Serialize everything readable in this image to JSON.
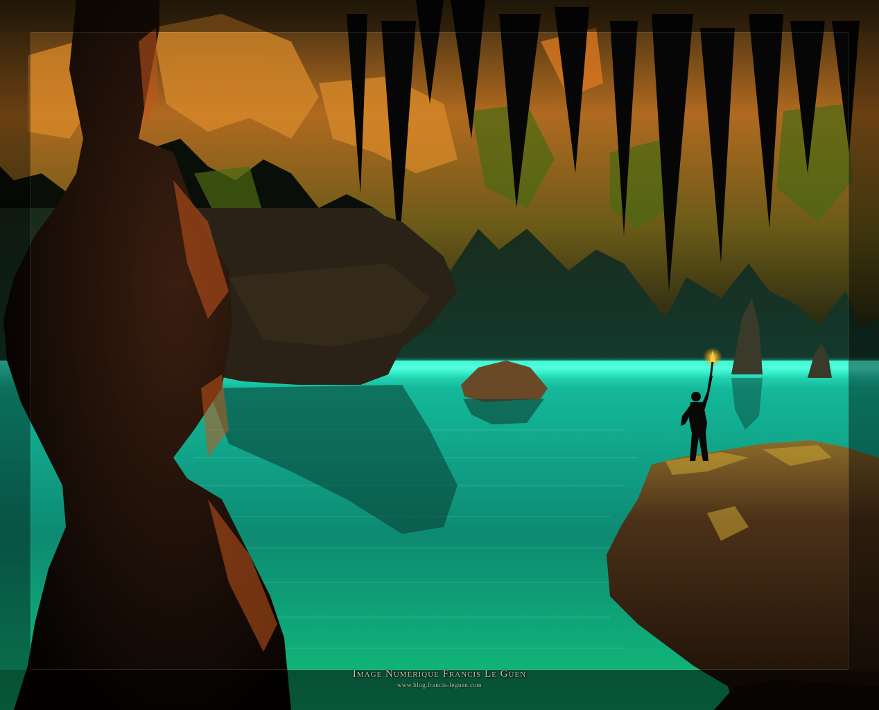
{
  "caption": {
    "title": "Image Numérique Francis Le Guen",
    "url": "www.blog.francis-leguen.com"
  },
  "colors": {
    "water": "#18c9a8",
    "water_glow": "#3affd8",
    "rock_dark": "#1a120c",
    "rock_lit": "#c0581a",
    "stalactite_gold": "#c9862a",
    "moss": "#5a7a1a",
    "torch_flame": "#ffcc33"
  },
  "scene": {
    "description_icons": [
      "cave-scene",
      "explorer-figure",
      "torch-icon"
    ]
  }
}
